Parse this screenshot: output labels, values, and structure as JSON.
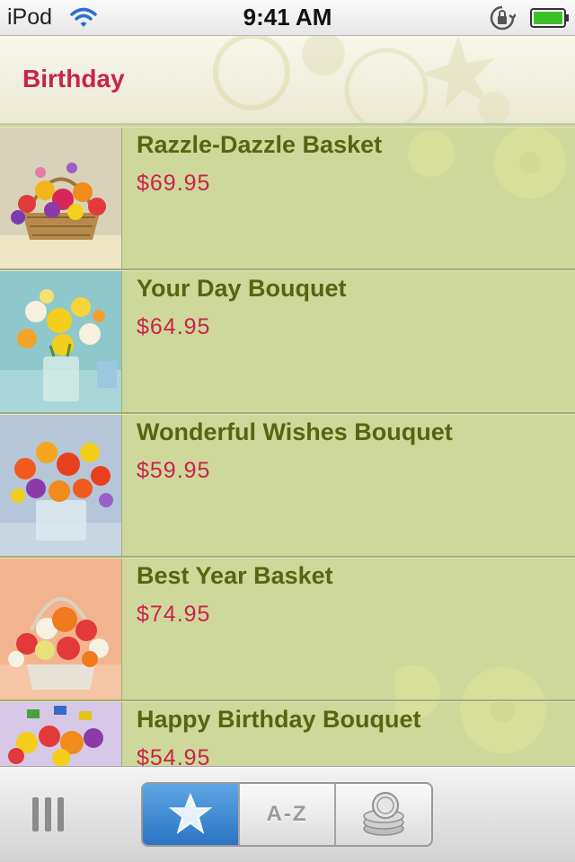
{
  "status_bar": {
    "carrier": "iPod",
    "time": "9:41 AM",
    "icons": [
      "wifi-icon",
      "rotation-lock-icon",
      "battery-icon"
    ]
  },
  "header": {
    "title": "Birthday"
  },
  "products": [
    {
      "name": "Razzle-Dazzle Basket",
      "price": "$69.95"
    },
    {
      "name": "Your Day Bouquet",
      "price": "$64.95"
    },
    {
      "name": "Wonderful Wishes Bouquet",
      "price": "$59.95"
    },
    {
      "name": "Best Year Basket",
      "price": "$74.95"
    },
    {
      "name": "Happy Birthday Bouquet",
      "price": "$54.95"
    }
  ],
  "tab_bar": {
    "segments": [
      {
        "id": "favorites",
        "icon": "star-icon",
        "label": "",
        "selected": true
      },
      {
        "id": "alphabetical",
        "icon": "",
        "label": "A-Z",
        "selected": false
      },
      {
        "id": "price",
        "icon": "coins-icon",
        "label": "",
        "selected": false
      }
    ],
    "menu_icon": "menu-icon"
  },
  "colors": {
    "title": "#c8244c",
    "product_name": "#5a6311",
    "price": "#c8244c",
    "list_background": "#cfd89b",
    "active_segment": "#3a86d4"
  }
}
